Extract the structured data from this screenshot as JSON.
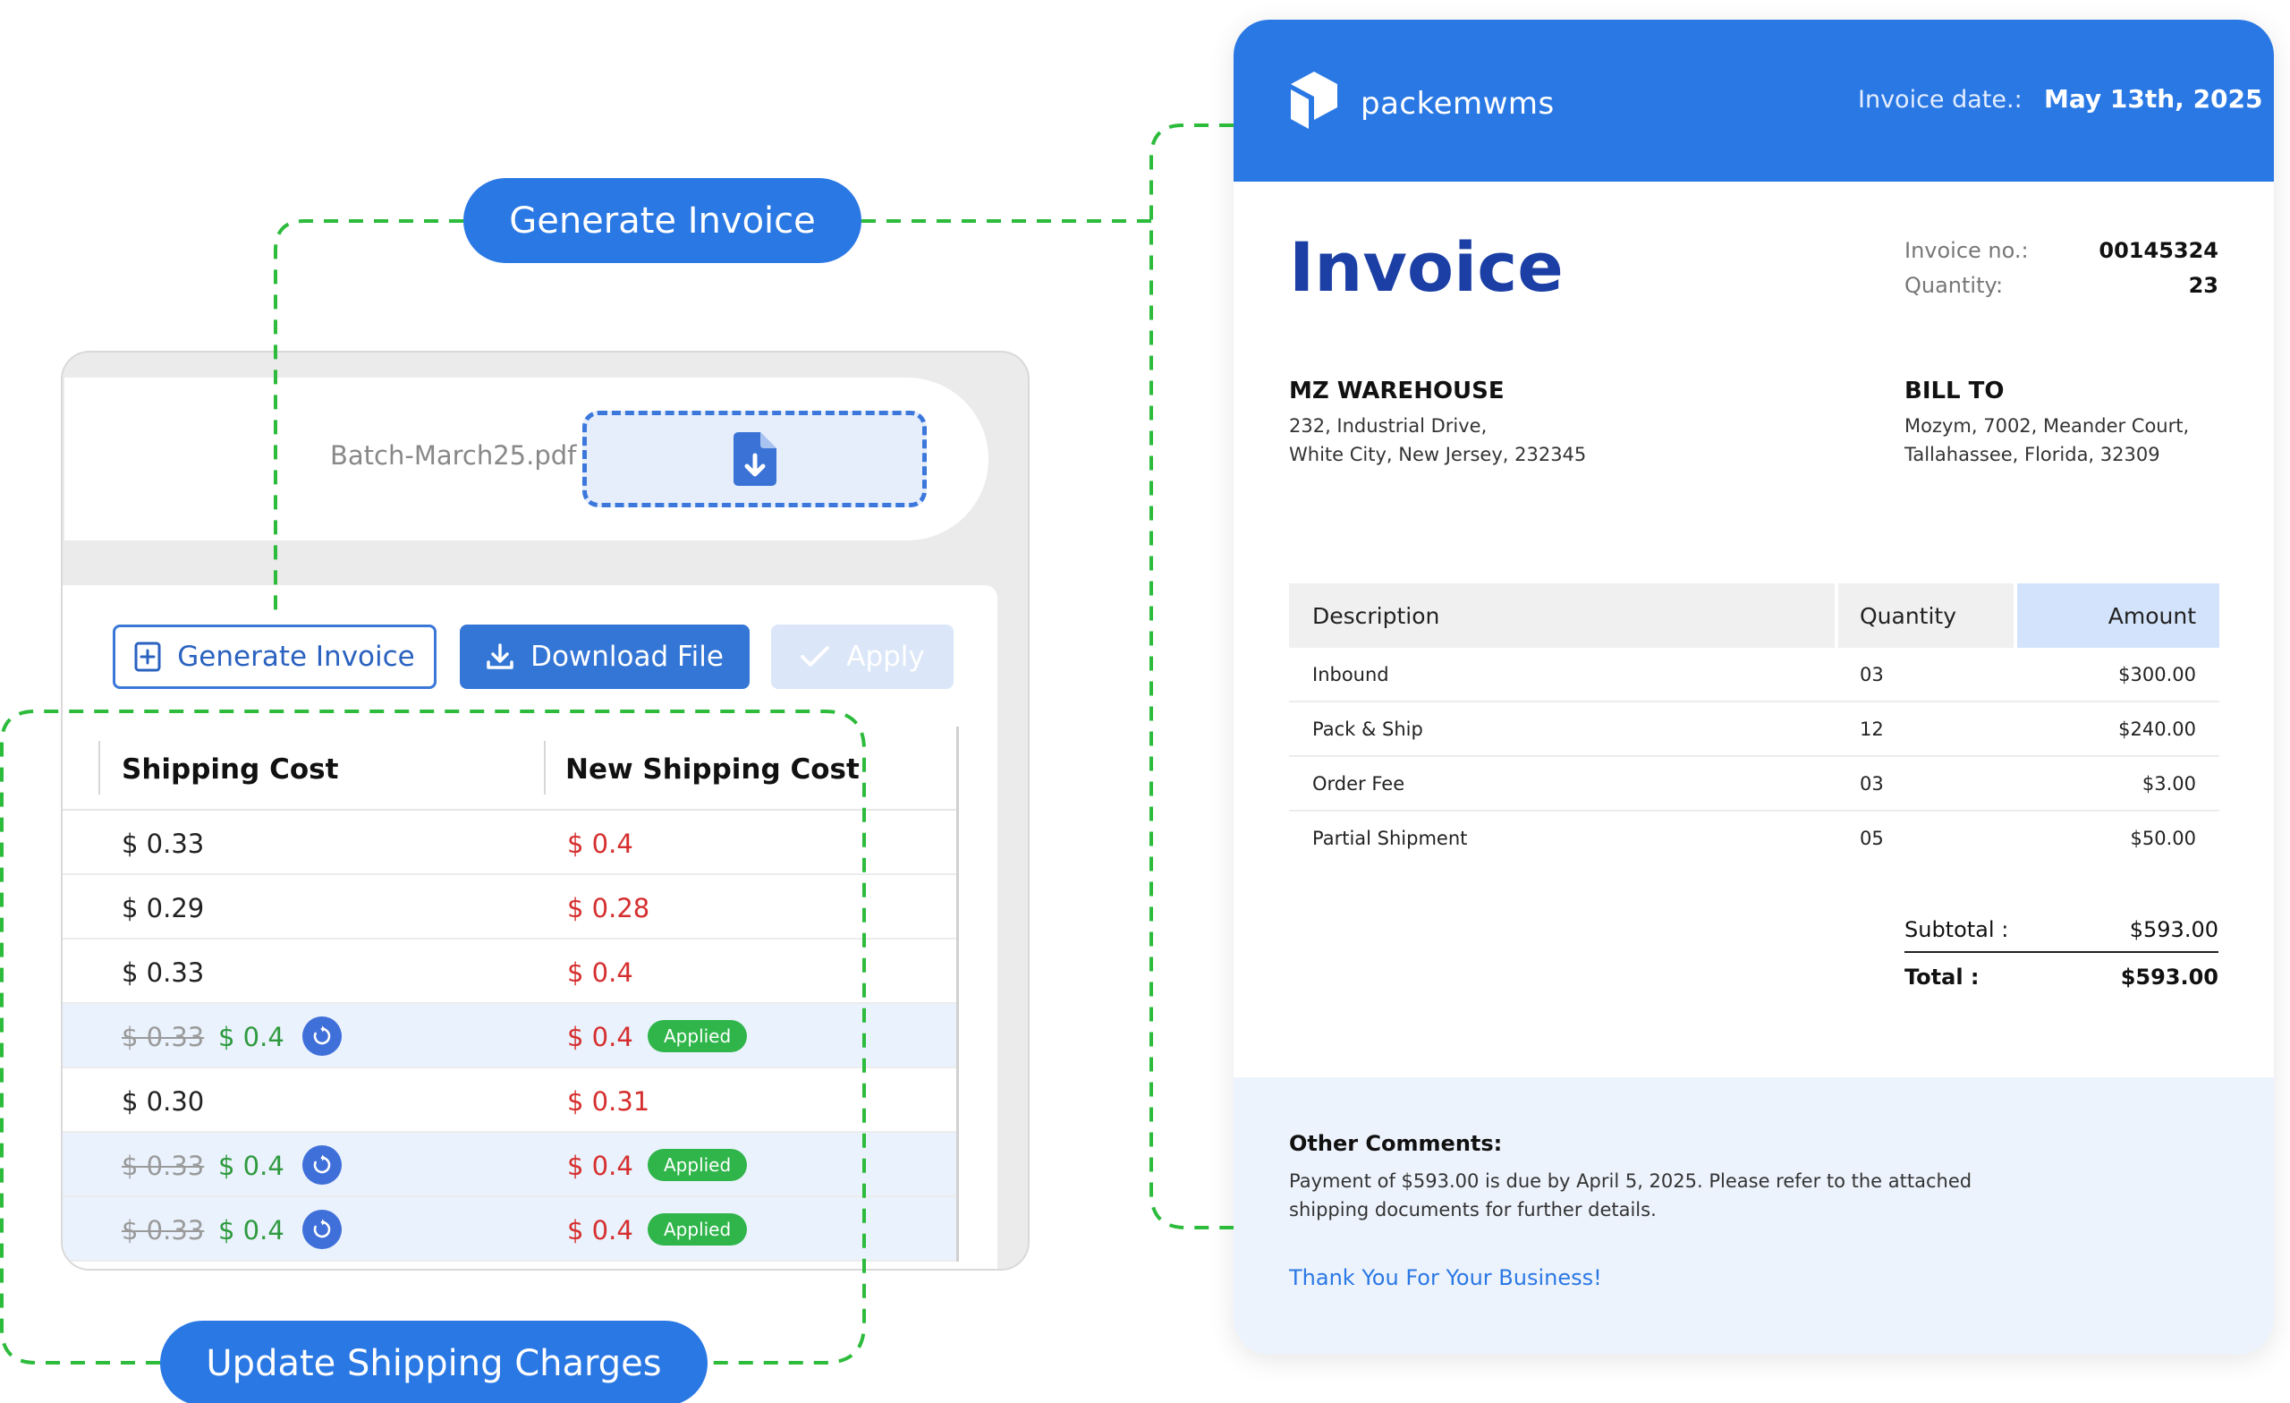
{
  "callouts": {
    "generate_invoice": "Generate Invoice",
    "update_shipping": "Update Shipping Charges"
  },
  "file": {
    "name": "Batch-March25.pdf",
    "icon": "file-download-icon"
  },
  "toolbar": {
    "generate_label": "Generate Invoice",
    "download_label": "Download File",
    "apply_label": "Apply"
  },
  "shipping_table": {
    "headers": [
      "Shipping Cost",
      "New Shipping Cost"
    ],
    "rows": [
      {
        "old": "$ 0.33",
        "override": "",
        "new": "$ 0.4",
        "badge": ""
      },
      {
        "old": "$ 0.29",
        "override": "",
        "new": "$ 0.28",
        "badge": ""
      },
      {
        "old": "$ 0.33",
        "override": "",
        "new": "$ 0.4",
        "badge": ""
      },
      {
        "old": "$ 0.33",
        "override": "$ 0.4",
        "new": "$ 0.4",
        "badge": "Applied"
      },
      {
        "old": "$ 0.30",
        "override": "",
        "new": "$ 0.31",
        "badge": ""
      },
      {
        "old": "$ 0.33",
        "override": "$ 0.4",
        "new": "$ 0.4",
        "badge": "Applied"
      },
      {
        "old": "$ 0.33",
        "override": "$ 0.4",
        "new": "$ 0.4",
        "badge": "Applied"
      }
    ]
  },
  "invoice": {
    "brand": "packemwms",
    "date_label": "Invoice date.:",
    "date_value": "May 13th, 2025",
    "title": "Invoice",
    "number_label": "Invoice no.:",
    "number_value": "00145324",
    "quantity_label": "Quantity:",
    "quantity_value": "23",
    "from": {
      "name": "MZ WAREHOUSE",
      "line1": "232, Industrial Drive,",
      "line2": "White City, New Jersey, 232345"
    },
    "to": {
      "name": "BILL TO",
      "line1": "Mozym, 7002, Meander Court,",
      "line2": "Tallahassee, Florida, 32309"
    },
    "table_headers": [
      "Description",
      "Quantity",
      "Amount"
    ],
    "items": [
      {
        "description": "Inbound",
        "quantity": "03",
        "amount": "$300.00"
      },
      {
        "description": "Pack & Ship",
        "quantity": "12",
        "amount": "$240.00"
      },
      {
        "description": "Order Fee",
        "quantity": "03",
        "amount": "$3.00"
      },
      {
        "description": "Partial Shipment",
        "quantity": "05",
        "amount": "$50.00"
      }
    ],
    "subtotal_label": "Subtotal :",
    "subtotal_value": "$593.00",
    "total_label": "Total :",
    "total_value": "$593.00",
    "comments_title": "Other Comments:",
    "comments_line1": "Payment of $593.00 is due by April 5, 2025. Please refer to the attached",
    "comments_line2": "shipping documents for further details.",
    "thanks": "Thank You For Your Business!"
  },
  "colors": {
    "brand_blue": "#2a78e4",
    "invoice_title": "#1b3fa5",
    "new_cost_red": "#d62e2e",
    "override_green": "#2e9a3e",
    "applied_badge": "#2fb54a",
    "connector_green": "#2dbb3c"
  }
}
